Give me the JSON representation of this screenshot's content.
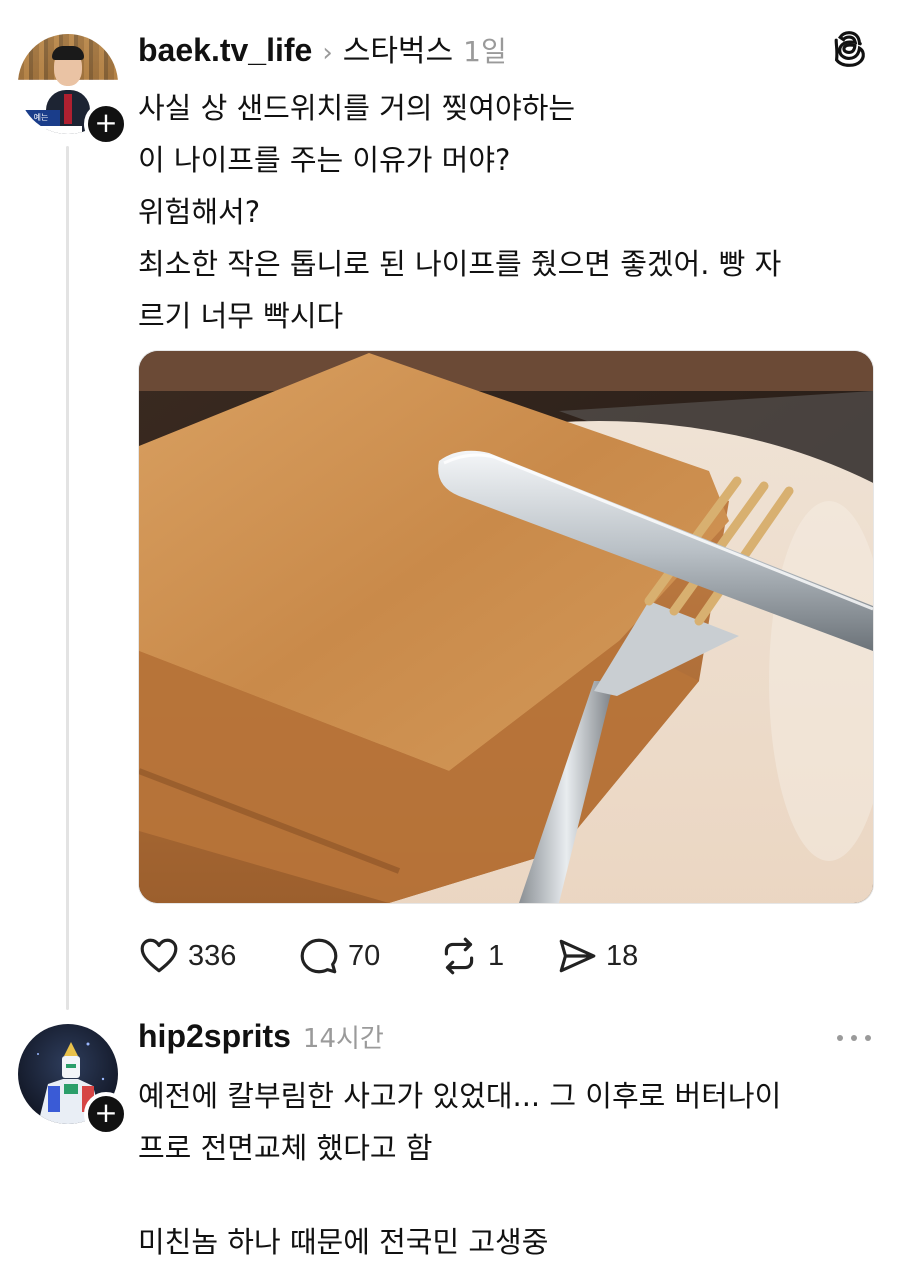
{
  "post": {
    "username": "baek.tv_life",
    "community": "스타벅스",
    "time": "1일",
    "avatar_caption": "예는",
    "avatar_caption2": "을 투자해 인",
    "lines": [
      "사실 상 샌드위치를 거의 찢여야하는",
      "이 나이프를 주는 이유가 머야?",
      "위험해서?",
      "최소한 작은 톱니로 된 나이프를 줬으면 좋겠어. 빵 자",
      "르기 너무 빡시다"
    ],
    "image_description_icon": "toast-with-butter-knife-and-fork-photo",
    "counts": {
      "likes": "336",
      "comments": "70",
      "reposts": "1",
      "shares": "18"
    }
  },
  "reply": {
    "username": "hip2sprits",
    "time": "14시간",
    "lines": [
      "예전에 칼부림한 사고가 있었대... 그 이후로 버터나이",
      "프로 전면교체 했다고 함"
    ],
    "extra_line": "미친놈 하나 때문에 전국민 고생중"
  },
  "ui": {
    "plus": "+",
    "chevron": "›",
    "accent": "#111111",
    "muted": "#9a9a9a"
  }
}
